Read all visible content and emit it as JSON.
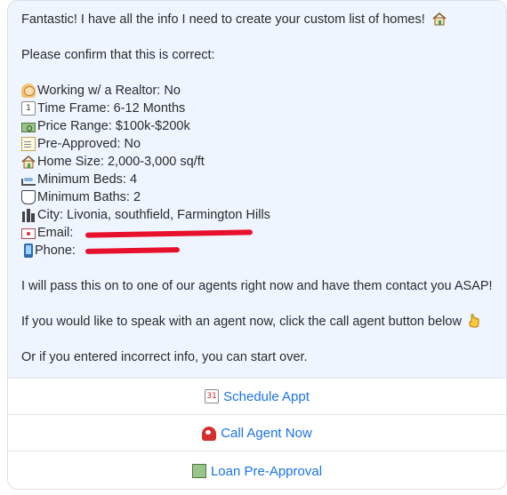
{
  "message": {
    "intro": "Fantastic! I have all the info I need to create your custom list of homes!",
    "confirm": "Please confirm that this is correct:",
    "details": [
      {
        "icon": "person-icon",
        "text": "Working w/ a Realtor: No"
      },
      {
        "icon": "calendar-icon",
        "text": "Time Frame: 6-12 Months"
      },
      {
        "icon": "money-icon",
        "text": "Price Range: $100k-$200k"
      },
      {
        "icon": "memo-icon",
        "text": "Pre-Approved: No"
      },
      {
        "icon": "house-icon",
        "text": "Home Size: 2,000-3,000 sq/ft"
      },
      {
        "icon": "bed-icon",
        "text": "Minimum Beds: 4"
      },
      {
        "icon": "toilet-icon",
        "text": "Minimum Baths: 2"
      },
      {
        "icon": "city-icon",
        "text": "City: Livonia, southfield, Farmington Hills"
      },
      {
        "icon": "email-icon",
        "text": "Email:"
      },
      {
        "icon": "phone-icon",
        "text": "Phone:"
      }
    ],
    "pass_on": "I will pass this on to one of our agents right now and have them contact you ASAP!",
    "speak": "If you would like to speak with an agent now, click the call agent button below",
    "restart": "Or if you entered incorrect info, you can start over."
  },
  "buttons": [
    {
      "icon": "calendar-icon",
      "label": "Schedule Appt"
    },
    {
      "icon": "telephone-icon",
      "label": "Call Agent Now"
    },
    {
      "icon": "money-icon",
      "label": "Loan Pre-Approval"
    }
  ],
  "colors": {
    "bubble_bg": "#eef5ff",
    "link": "#1a73e8",
    "redaction": "#e8112d"
  }
}
